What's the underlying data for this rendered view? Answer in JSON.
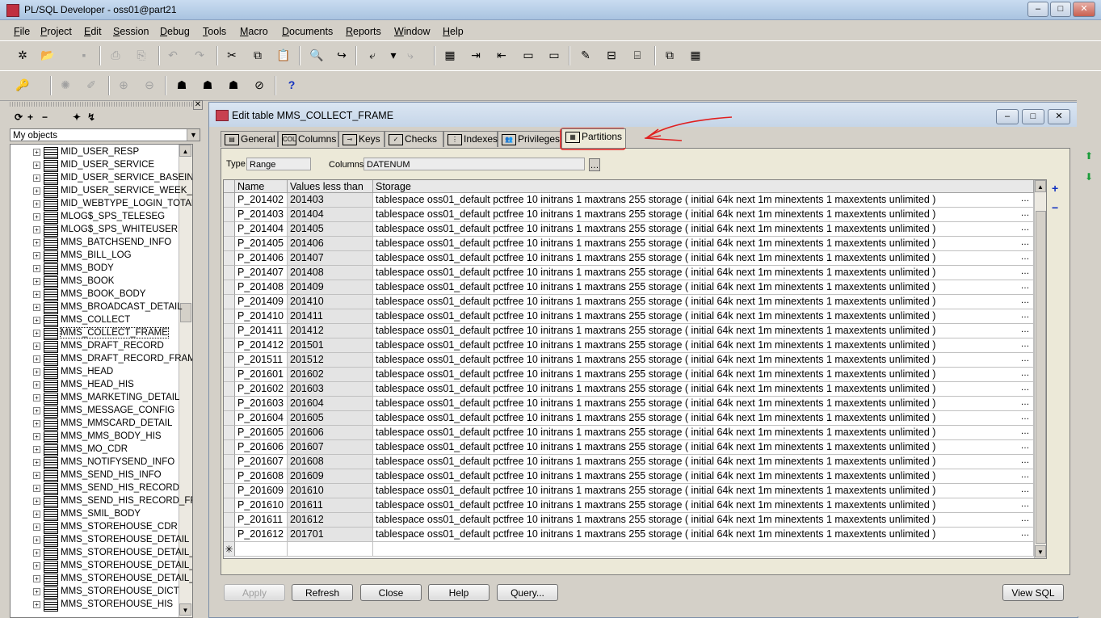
{
  "app": {
    "title": "PL/SQL Developer - oss01@part21"
  },
  "window_buttons": {
    "minimize": "–",
    "maximize": "□",
    "close": "✕"
  },
  "menu": [
    "File",
    "Project",
    "Edit",
    "Session",
    "Debug",
    "Tools",
    "Macro",
    "Documents",
    "Reports",
    "Window",
    "Help"
  ],
  "toolbar1": [
    "new-icon",
    "open-icon",
    "save-icon",
    "print-icon",
    "print-preview-icon",
    "undo-icon",
    "redo-icon",
    "cut-icon",
    "copy-icon",
    "paste-icon",
    "find-icon",
    "find-next-icon",
    "load-icon",
    "load-arrow-icon",
    "execute-file-icon",
    "grid-icon",
    "indent-icon",
    "unindent-icon",
    "uppercase-icon",
    "lowercase-icon",
    "comment-icon",
    "uncomment-icon",
    "db-icon",
    "window-list-icon",
    "table-list-icon"
  ],
  "toolbar2": [
    "key-icon",
    "gear-icon",
    "edit-pencil-icon",
    "commit-icon",
    "rollback-icon",
    "connect-icon",
    "sql-icon",
    "execute-icon",
    "stop-icon",
    "help-icon"
  ],
  "help_glyph": "?",
  "object_panel": {
    "close_glyph": "✕",
    "tool_glyphs": [
      "⟳",
      "+",
      "−",
      "✦",
      "↯"
    ],
    "filter": "My objects",
    "items": [
      "MID_USER_RESP",
      "MID_USER_SERVICE",
      "MID_USER_SERVICE_BASEINF",
      "MID_USER_SERVICE_WEEK_T",
      "MID_WEBTYPE_LOGIN_TOTAL",
      "MLOG$_SPS_TELESEG",
      "MLOG$_SPS_WHITEUSER",
      "MMS_BATCHSEND_INFO",
      "MMS_BILL_LOG",
      "MMS_BODY",
      "MMS_BOOK",
      "MMS_BOOK_BODY",
      "MMS_BROADCAST_DETAIL",
      "MMS_COLLECT",
      "MMS_COLLECT_FRAME",
      "MMS_DRAFT_RECORD",
      "MMS_DRAFT_RECORD_FRAM",
      "MMS_HEAD",
      "MMS_HEAD_HIS",
      "MMS_MARKETING_DETAIL",
      "MMS_MESSAGE_CONFIG",
      "MMS_MMSCARD_DETAIL",
      "MMS_MMS_BODY_HIS",
      "MMS_MO_CDR",
      "MMS_NOTIFYSEND_INFO",
      "MMS_SEND_HIS_INFO",
      "MMS_SEND_HIS_RECORD",
      "MMS_SEND_HIS_RECORD_FR",
      "MMS_SMIL_BODY",
      "MMS_STOREHOUSE_CDR",
      "MMS_STOREHOUSE_DETAIL",
      "MMS_STOREHOUSE_DETAIL_",
      "MMS_STOREHOUSE_DETAIL_",
      "MMS_STOREHOUSE_DETAIL_",
      "MMS_STOREHOUSE_DICT",
      "MMS_STOREHOUSE_HIS"
    ]
  },
  "edit_window": {
    "title": "Edit table MMS_COLLECT_FRAME",
    "tabs": [
      {
        "label": "General",
        "icon": "general-icon",
        "glyph": "▤"
      },
      {
        "label": "Columns",
        "icon": "columns-icon",
        "glyph": "COL"
      },
      {
        "label": "Keys",
        "icon": "keys-icon",
        "glyph": "⊸"
      },
      {
        "label": "Checks",
        "icon": "checks-icon",
        "glyph": "✓"
      },
      {
        "label": "Indexes",
        "icon": "indexes-icon",
        "glyph": "⋮"
      },
      {
        "label": "Privileges",
        "icon": "privileges-icon",
        "glyph": "👥"
      },
      {
        "label": "Partitions",
        "icon": "partitions-icon",
        "glyph": "▦"
      }
    ],
    "active_tab": "Partitions",
    "type_label": "Type",
    "type_value": "Range",
    "columns_label": "Columns",
    "columns_value": "DATENUM",
    "browse_glyph": "…",
    "add_glyph": "+",
    "remove_glyph": "−",
    "new_row_glyph": "✳",
    "grid": {
      "headers": [
        "Name",
        "Values less than",
        "Storage"
      ],
      "storage": "tablespace oss01_default pctfree 10 initrans 1 maxtrans 255 storage ( initial 64k next 1m minextents 1 maxextents unlimited )",
      "rows": [
        [
          "P_201402",
          "201403"
        ],
        [
          "P_201403",
          "201404"
        ],
        [
          "P_201404",
          "201405"
        ],
        [
          "P_201405",
          "201406"
        ],
        [
          "P_201406",
          "201407"
        ],
        [
          "P_201407",
          "201408"
        ],
        [
          "P_201408",
          "201409"
        ],
        [
          "P_201409",
          "201410"
        ],
        [
          "P_201410",
          "201411"
        ],
        [
          "P_201411",
          "201412"
        ],
        [
          "P_201412",
          "201501"
        ],
        [
          "P_201511",
          "201512"
        ],
        [
          "P_201601",
          "201602"
        ],
        [
          "P_201602",
          "201603"
        ],
        [
          "P_201603",
          "201604"
        ],
        [
          "P_201604",
          "201605"
        ],
        [
          "P_201605",
          "201606"
        ],
        [
          "P_201606",
          "201607"
        ],
        [
          "P_201607",
          "201608"
        ],
        [
          "P_201608",
          "201609"
        ],
        [
          "P_201609",
          "201610"
        ],
        [
          "P_201610",
          "201611"
        ],
        [
          "P_201611",
          "201612"
        ],
        [
          "P_201612",
          "201701"
        ]
      ]
    },
    "buttons": {
      "apply": "Apply",
      "refresh": "Refresh",
      "close": "Close",
      "help": "Help",
      "query": "Query...",
      "view_sql": "View SQL"
    }
  },
  "colors": {
    "annotation": "#e02020",
    "title_gradient": "#c5d5e8"
  }
}
